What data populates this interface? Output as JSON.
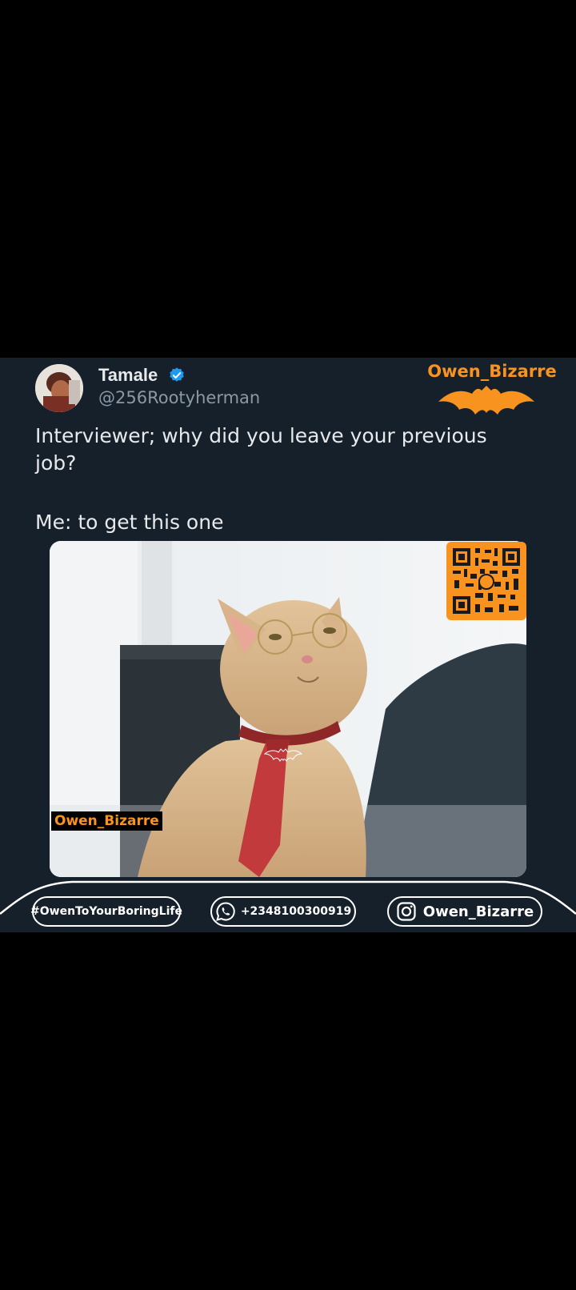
{
  "post": {
    "display_name": "Tamale",
    "handle": "@256Rootyherman",
    "verified": true,
    "text_line1": "Interviewer; why did you leave your previous",
    "text_line2": "job?",
    "text_line3": "Me: to get this one"
  },
  "branding": {
    "top_logo_text": "Owen_Bizarre",
    "image_watermark": "Owen_Bizarre",
    "accent_color": "#f7931e"
  },
  "footer": {
    "hashtag": "#OwenToYourBoringLife",
    "phone": "+2348100300919",
    "instagram": "Owen_Bizarre"
  },
  "icons": {
    "verified": "verified-badge-icon",
    "bat": "bat-logo-icon",
    "qr": "qr-code-icon",
    "whatsapp": "whatsapp-icon",
    "instagram": "instagram-icon"
  },
  "colors": {
    "card_bg": "#15202b",
    "text_primary": "#e7e9ea",
    "text_secondary": "#8b98a5",
    "verified_blue": "#1d9bf0"
  }
}
